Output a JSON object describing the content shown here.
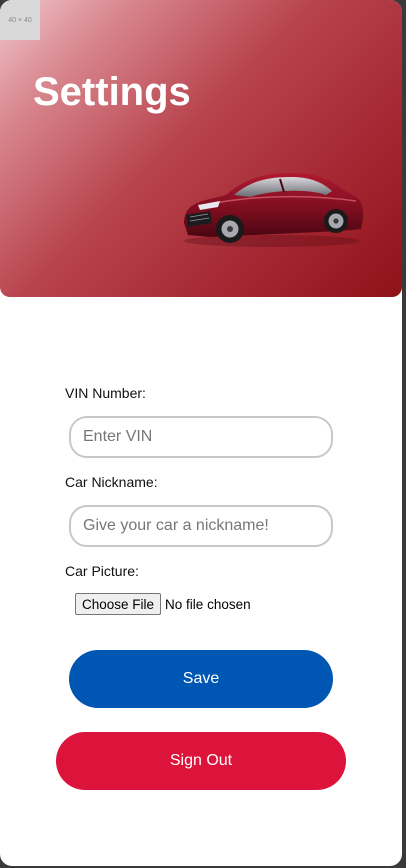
{
  "placeholder_image": {
    "label": "40 × 40"
  },
  "header": {
    "title": "Settings"
  },
  "form": {
    "vin": {
      "label": "VIN Number:",
      "placeholder": "Enter VIN"
    },
    "nickname": {
      "label": "Car Nickname:",
      "placeholder": "Give your car a nickname!"
    },
    "picture": {
      "label": "Car Picture:",
      "button_label": "Choose File",
      "status": "No file chosen"
    }
  },
  "actions": {
    "save_label": "Save",
    "signout_label": "Sign Out"
  },
  "colors": {
    "save_button": "#0057b3",
    "signout_button": "#dc143c",
    "hero_dark": "#8f1219",
    "hero_light": "#f0c8cc"
  }
}
